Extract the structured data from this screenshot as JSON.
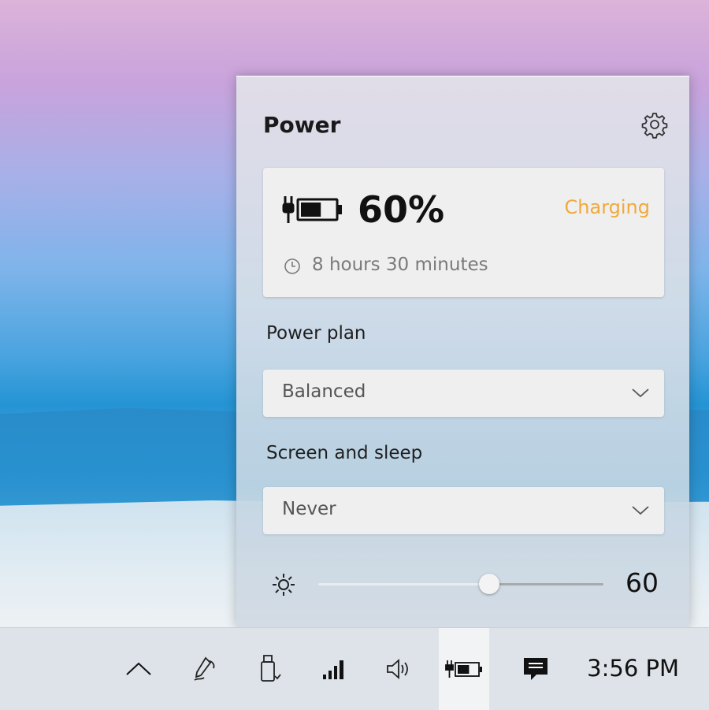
{
  "panel": {
    "title": "Power",
    "settings_icon": "gear-icon",
    "battery": {
      "percent_text": "60%",
      "status": "Charging",
      "status_color": "#f0a93b",
      "remaining": "8 hours 30 minutes",
      "level": 0.6
    },
    "power_plan": {
      "label": "Power plan",
      "selected": "Balanced"
    },
    "screen_sleep": {
      "label": "Screen and sleep",
      "selected": "Never"
    },
    "brightness": {
      "value": 60,
      "value_text": "60"
    }
  },
  "taskbar": {
    "icons": [
      "chevron-up-icon",
      "pen-icon",
      "usb-icon",
      "signal-icon",
      "volume-icon",
      "battery-charging-icon",
      "notification-icon"
    ],
    "time": "3:56 PM"
  }
}
